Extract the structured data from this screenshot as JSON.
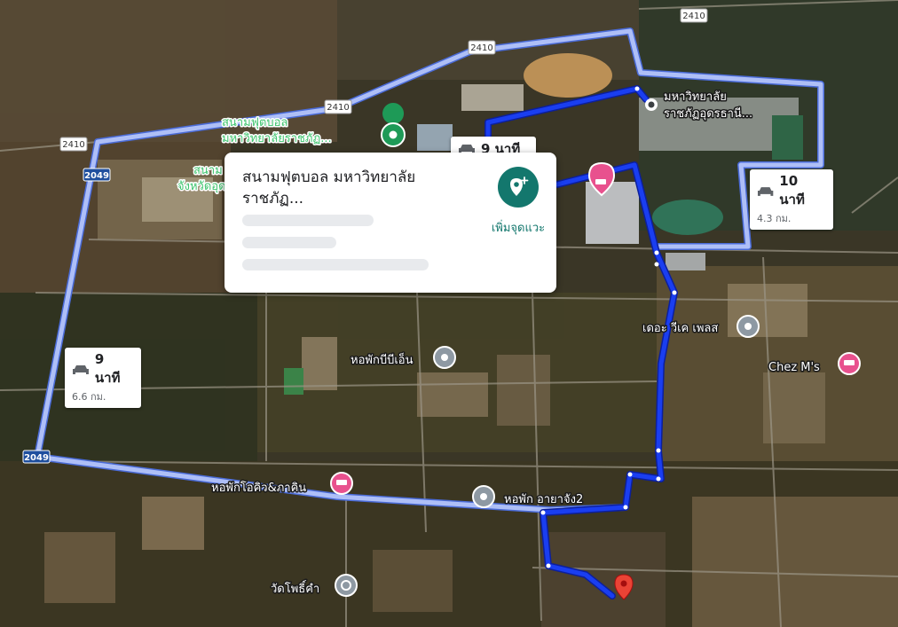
{
  "map": {
    "road_shields": [
      {
        "id": "2410-a",
        "text": "2410"
      },
      {
        "id": "2410-b",
        "text": "2410"
      },
      {
        "id": "2410-c",
        "text": "2410"
      },
      {
        "id": "2410-d",
        "text": "2410"
      },
      {
        "id": "2049-a",
        "text": "2049"
      },
      {
        "id": "2049-b",
        "text": "2049"
      }
    ],
    "places": {
      "football_field": "สนามฟุตบอล",
      "football_field_2": "มหาวิทยาลัยราชภัฏ...",
      "province_a": "สนาม",
      "province_b": "จังหวัดอุด",
      "university_1": "มหาวิทยาลัย",
      "university_2": "ราชภัฏอุดรธานี...",
      "the_week_place": "เดอะ วีเค เพลส",
      "dorm_bbn": "หอพักบีบีเอ็น",
      "chez_ms": "Chez M's",
      "dorm_oq": "หอพักโอคิว&ภาคิน",
      "dorm_ayachang": "หอพัก อายาจัง2",
      "wat_pho_kham": "วัดโพธิ์คำ"
    },
    "route_colors": {
      "primary": "#1a3ef0",
      "alternate": "#aebff7"
    }
  },
  "routes": {
    "alt_left": {
      "time": "9 นาที",
      "distance": "6.6 กม."
    },
    "alt_right": {
      "time": "10 นาที",
      "distance": "4.3 กม."
    },
    "hidden_tag": {
      "time": "9 นาที"
    }
  },
  "popup": {
    "title": "สนามฟุตบอล มหาวิทยาลัยราชภัฏ...",
    "add_stop_label": "เพิ่มจุดแวะ",
    "add_stop_icon": "add-location-icon"
  }
}
